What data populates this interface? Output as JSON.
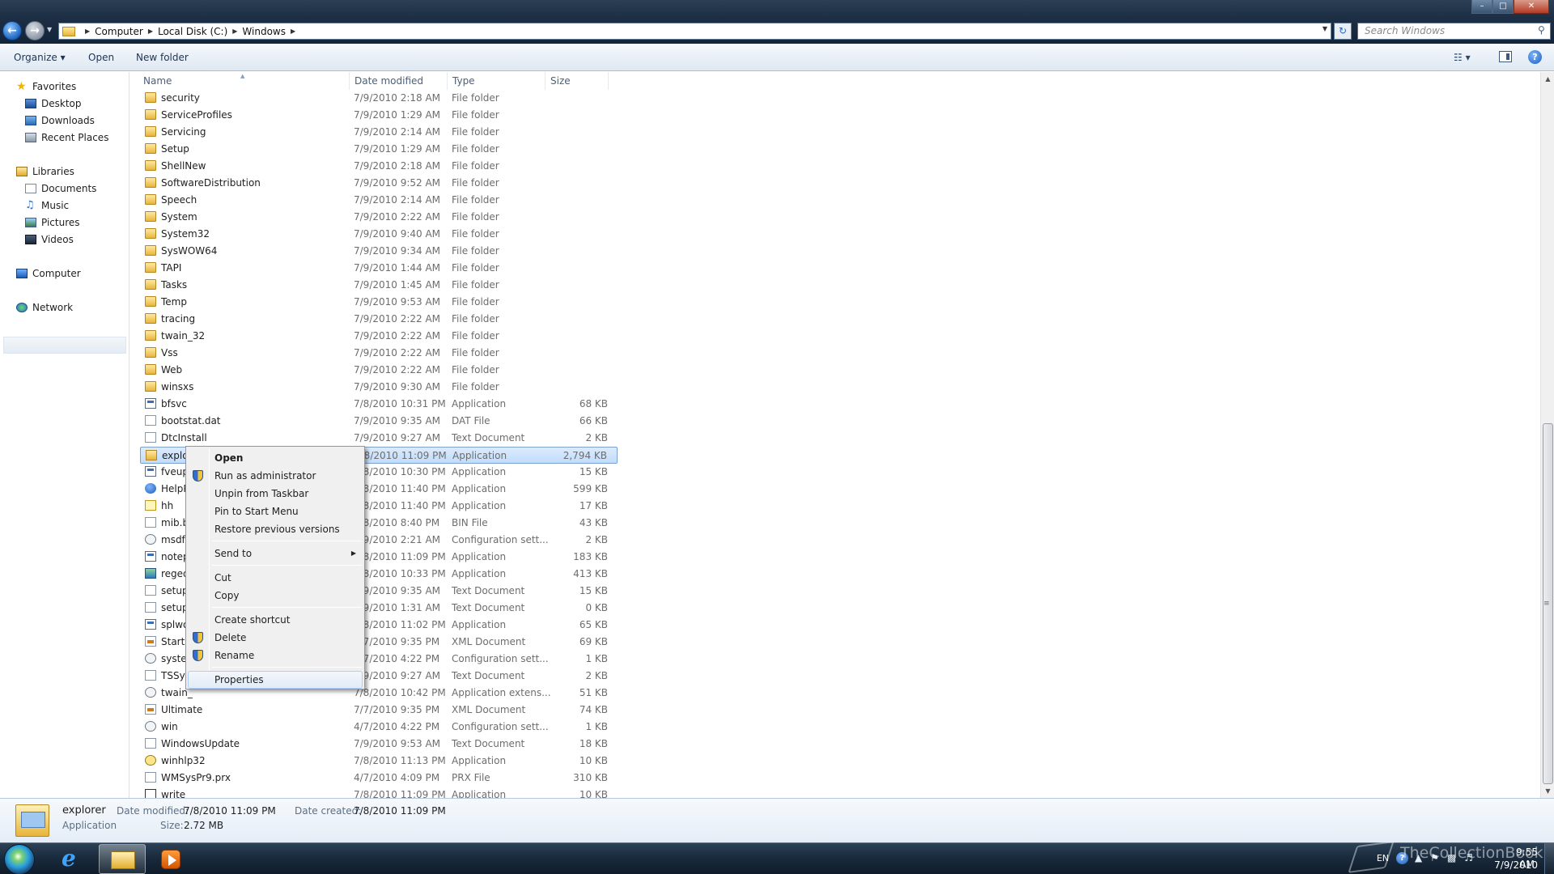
{
  "window": {
    "controls": {
      "minimize": "–",
      "maximize": "□",
      "close": "✕"
    }
  },
  "address": {
    "crumbs": [
      "Computer",
      "Local Disk (C:)",
      "Windows"
    ],
    "search_placeholder": "Search Windows"
  },
  "toolbar": {
    "organize": "Organize ▾",
    "open": "Open",
    "new_folder": "New folder",
    "views_icon": "☷ ▾"
  },
  "nav": {
    "favorites": "Favorites",
    "desktop": "Desktop",
    "downloads": "Downloads",
    "recent": "Recent Places",
    "libraries": "Libraries",
    "documents": "Documents",
    "music": "Music",
    "pictures": "Pictures",
    "videos": "Videos",
    "computer": "Computer",
    "network": "Network"
  },
  "columns": {
    "name": "Name",
    "date": "Date modified",
    "type": "Type",
    "size": "Size"
  },
  "files": [
    {
      "name": "security",
      "date": "7/9/2010 2:18 AM",
      "type": "File folder",
      "size": "",
      "icon": "folder"
    },
    {
      "name": "ServiceProfiles",
      "date": "7/9/2010 1:29 AM",
      "type": "File folder",
      "size": "",
      "icon": "folder"
    },
    {
      "name": "Servicing",
      "date": "7/9/2010 2:14 AM",
      "type": "File folder",
      "size": "",
      "icon": "folder"
    },
    {
      "name": "Setup",
      "date": "7/9/2010 1:29 AM",
      "type": "File folder",
      "size": "",
      "icon": "folder"
    },
    {
      "name": "ShellNew",
      "date": "7/9/2010 2:18 AM",
      "type": "File folder",
      "size": "",
      "icon": "folder"
    },
    {
      "name": "SoftwareDistribution",
      "date": "7/9/2010 9:52 AM",
      "type": "File folder",
      "size": "",
      "icon": "folder"
    },
    {
      "name": "Speech",
      "date": "7/9/2010 2:14 AM",
      "type": "File folder",
      "size": "",
      "icon": "folder"
    },
    {
      "name": "System",
      "date": "7/9/2010 2:22 AM",
      "type": "File folder",
      "size": "",
      "icon": "folder"
    },
    {
      "name": "System32",
      "date": "7/9/2010 9:40 AM",
      "type": "File folder",
      "size": "",
      "icon": "folder"
    },
    {
      "name": "SysWOW64",
      "date": "7/9/2010 9:34 AM",
      "type": "File folder",
      "size": "",
      "icon": "folder"
    },
    {
      "name": "TAPI",
      "date": "7/9/2010 1:44 AM",
      "type": "File folder",
      "size": "",
      "icon": "folder"
    },
    {
      "name": "Tasks",
      "date": "7/9/2010 1:45 AM",
      "type": "File folder",
      "size": "",
      "icon": "folder"
    },
    {
      "name": "Temp",
      "date": "7/9/2010 9:53 AM",
      "type": "File folder",
      "size": "",
      "icon": "folder"
    },
    {
      "name": "tracing",
      "date": "7/9/2010 2:22 AM",
      "type": "File folder",
      "size": "",
      "icon": "folder"
    },
    {
      "name": "twain_32",
      "date": "7/9/2010 2:22 AM",
      "type": "File folder",
      "size": "",
      "icon": "folder"
    },
    {
      "name": "Vss",
      "date": "7/9/2010 2:22 AM",
      "type": "File folder",
      "size": "",
      "icon": "folder"
    },
    {
      "name": "Web",
      "date": "7/9/2010 2:22 AM",
      "type": "File folder",
      "size": "",
      "icon": "folder"
    },
    {
      "name": "winsxs",
      "date": "7/9/2010 9:30 AM",
      "type": "File folder",
      "size": "",
      "icon": "folder"
    },
    {
      "name": "bfsvc",
      "date": "7/8/2010 10:31 PM",
      "type": "Application",
      "size": "68 KB",
      "icon": "app"
    },
    {
      "name": "bootstat.dat",
      "date": "7/9/2010 9:35 AM",
      "type": "DAT File",
      "size": "66 KB",
      "icon": "doc"
    },
    {
      "name": "DtcInstall",
      "date": "7/9/2010 9:27 AM",
      "type": "Text Document",
      "size": "2 KB",
      "icon": "doc"
    },
    {
      "name": "explor",
      "date": "7/8/2010 11:09 PM",
      "type": "Application",
      "size": "2,794 KB",
      "icon": "explorer",
      "selected": true
    },
    {
      "name": "fveup",
      "date": "7/8/2010 10:30 PM",
      "type": "Application",
      "size": "15 KB",
      "icon": "app"
    },
    {
      "name": "HelpP",
      "date": "7/8/2010 11:40 PM",
      "type": "Application",
      "size": "599 KB",
      "icon": "help"
    },
    {
      "name": "hh",
      "date": "7/8/2010 11:40 PM",
      "type": "Application",
      "size": "17 KB",
      "icon": "hh"
    },
    {
      "name": "mib.b",
      "date": "7/8/2010 8:40 PM",
      "type": "BIN File",
      "size": "43 KB",
      "icon": "doc"
    },
    {
      "name": "msdfr",
      "date": "7/9/2010 2:21 AM",
      "type": "Configuration sett...",
      "size": "2 KB",
      "icon": "cfg"
    },
    {
      "name": "notep",
      "date": "7/8/2010 11:09 PM",
      "type": "Application",
      "size": "183 KB",
      "icon": "app"
    },
    {
      "name": "reged",
      "date": "7/8/2010 10:33 PM",
      "type": "Application",
      "size": "413 KB",
      "icon": "reg"
    },
    {
      "name": "setup",
      "date": "7/9/2010 9:35 AM",
      "type": "Text Document",
      "size": "15 KB",
      "icon": "doc"
    },
    {
      "name": "setup",
      "date": "7/9/2010 1:31 AM",
      "type": "Text Document",
      "size": "0 KB",
      "icon": "doc"
    },
    {
      "name": "splwo",
      "date": "7/8/2010 11:02 PM",
      "type": "Application",
      "size": "65 KB",
      "icon": "app"
    },
    {
      "name": "Starte",
      "date": "7/7/2010 9:35 PM",
      "type": "XML Document",
      "size": "69 KB",
      "icon": "xml"
    },
    {
      "name": "syster",
      "date": "4/7/2010 4:22 PM",
      "type": "Configuration sett...",
      "size": "1 KB",
      "icon": "cfg"
    },
    {
      "name": "TSSys",
      "date": "7/9/2010 9:27 AM",
      "type": "Text Document",
      "size": "2 KB",
      "icon": "doc"
    },
    {
      "name": "twain_",
      "date": "7/8/2010 10:42 PM",
      "type": "Application extens...",
      "size": "51 KB",
      "icon": "cfg"
    },
    {
      "name": "Ultimate",
      "date": "7/7/2010 9:35 PM",
      "type": "XML Document",
      "size": "74 KB",
      "icon": "xml"
    },
    {
      "name": "win",
      "date": "4/7/2010 4:22 PM",
      "type": "Configuration sett...",
      "size": "1 KB",
      "icon": "cfg"
    },
    {
      "name": "WindowsUpdate",
      "date": "7/9/2010 9:53 AM",
      "type": "Text Document",
      "size": "18 KB",
      "icon": "doc"
    },
    {
      "name": "winhlp32",
      "date": "7/8/2010 11:13 PM",
      "type": "Application",
      "size": "10 KB",
      "icon": "winhlp"
    },
    {
      "name": "WMSysPr9.prx",
      "date": "4/7/2010 4:09 PM",
      "type": "PRX File",
      "size": "310 KB",
      "icon": "doc"
    },
    {
      "name": "write",
      "date": "7/8/2010 11:09 PM",
      "type": "Application",
      "size": "10 KB",
      "icon": "write"
    }
  ],
  "context_menu": {
    "open": "Open",
    "run_admin": "Run as administrator",
    "unpin_taskbar": "Unpin from Taskbar",
    "pin_start": "Pin to Start Menu",
    "restore": "Restore previous versions",
    "send_to": "Send to",
    "cut": "Cut",
    "copy": "Copy",
    "create_shortcut": "Create shortcut",
    "delete": "Delete",
    "rename": "Rename",
    "properties": "Properties"
  },
  "details": {
    "name": "explorer",
    "kind": "Application",
    "modified_label": "Date modified:",
    "modified_value": "7/8/2010 11:09 PM",
    "size_label": "Size:",
    "size_value": "2.72 MB",
    "created_label": "Date created:",
    "created_value": "7/8/2010 11:09 PM"
  },
  "tray": {
    "lang": "EN",
    "time": "9:55 AM",
    "date": "7/9/2010",
    "watermark": "TheCollectionBook"
  }
}
